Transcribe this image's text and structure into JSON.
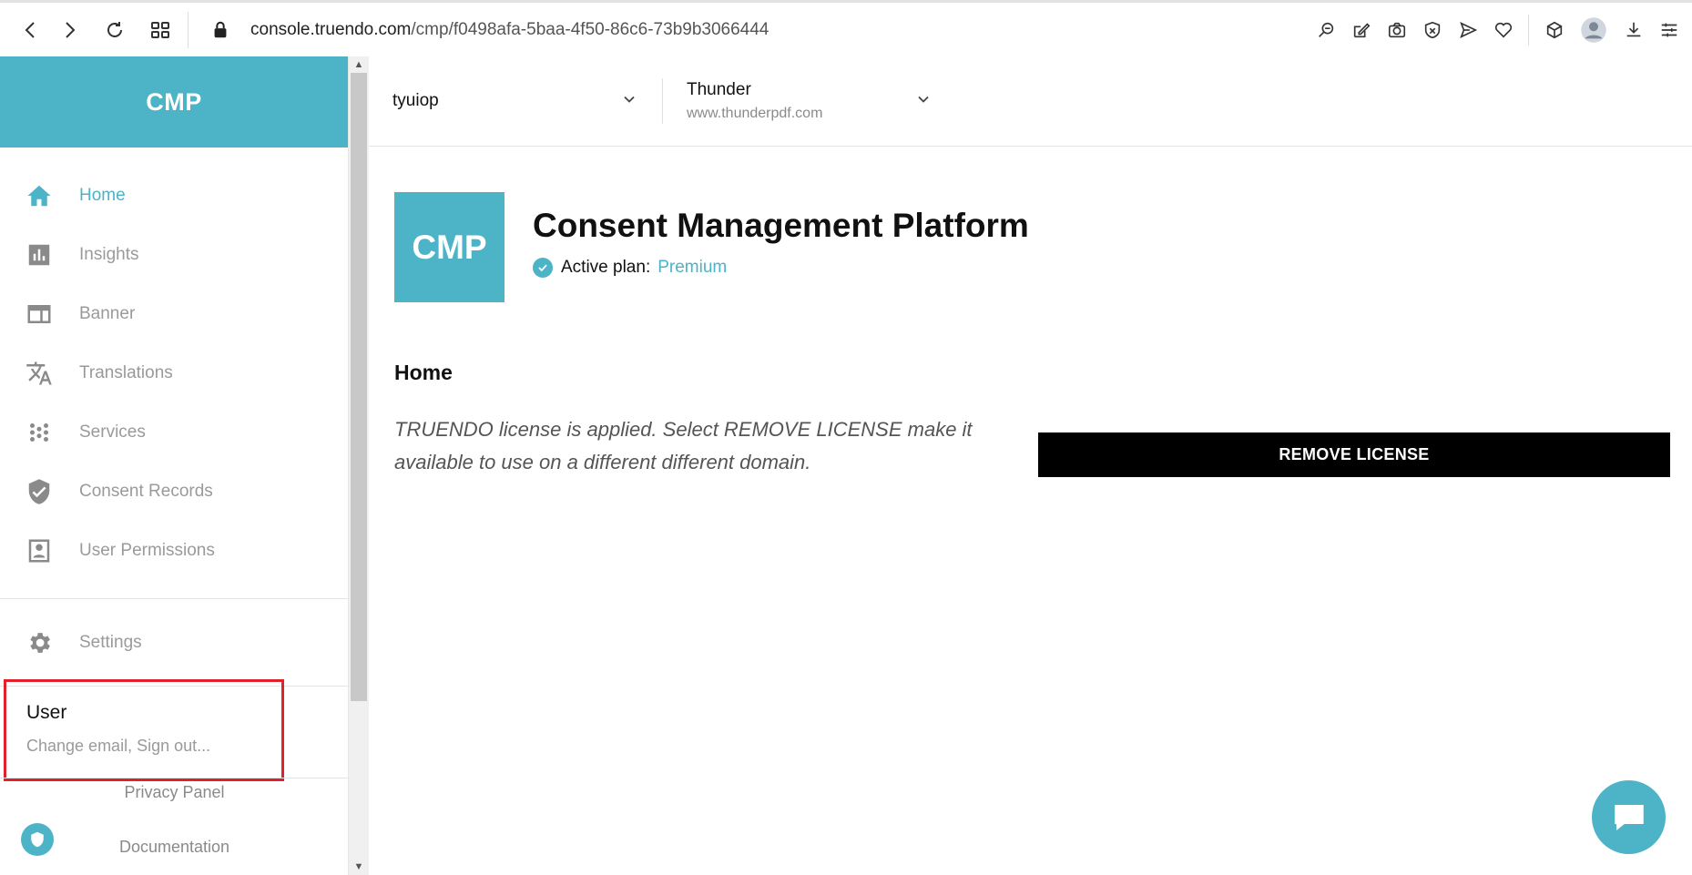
{
  "browser": {
    "url_host": "console.truendo.com",
    "url_path": "/cmp/f0498afa-5baa-4f50-86c6-73b9b3066444",
    "icons": [
      "back-icon",
      "forward-icon",
      "reload-icon",
      "tabs-grid-icon",
      "lock-icon",
      "zoom-icon",
      "edit-icon",
      "camera-icon",
      "shield-x-icon",
      "send-icon",
      "heart-icon",
      "cube-icon",
      "profile-icon",
      "download-icon",
      "menu-icon"
    ]
  },
  "sidebar": {
    "brand": "CMP",
    "items": [
      {
        "label": "Home",
        "icon": "home-icon",
        "active": true
      },
      {
        "label": "Insights",
        "icon": "bar-chart-icon",
        "active": false
      },
      {
        "label": "Banner",
        "icon": "banner-icon",
        "active": false
      },
      {
        "label": "Translations",
        "icon": "translate-icon",
        "active": false
      },
      {
        "label": "Services",
        "icon": "dots-grid-icon",
        "active": false
      },
      {
        "label": "Consent Records",
        "icon": "shield-check-icon",
        "active": false
      },
      {
        "label": "User Permissions",
        "icon": "user-badge-icon",
        "active": false
      }
    ],
    "settings": {
      "label": "Settings",
      "icon": "gear-icon"
    },
    "user": {
      "title": "User",
      "subtitle": "Change email, Sign out..."
    },
    "privacy_panel": "Privacy Panel",
    "documentation": "Documentation"
  },
  "topbar": {
    "account": "tyuiop",
    "domain_name": "Thunder",
    "domain_url": "www.thunderpdf.com"
  },
  "hero": {
    "logo": "CMP",
    "title": "Consent Management Platform",
    "plan_label": "Active plan:",
    "plan_value": "Premium"
  },
  "content": {
    "section_title": "Home",
    "license_text": "TRUENDO license is applied. Select REMOVE LICENSE make it available to use on a different different domain.",
    "remove_button": "REMOVE LICENSE"
  },
  "colors": {
    "accent": "#4db3c6",
    "highlight_border": "#e0202b",
    "button_bg": "#000000"
  }
}
